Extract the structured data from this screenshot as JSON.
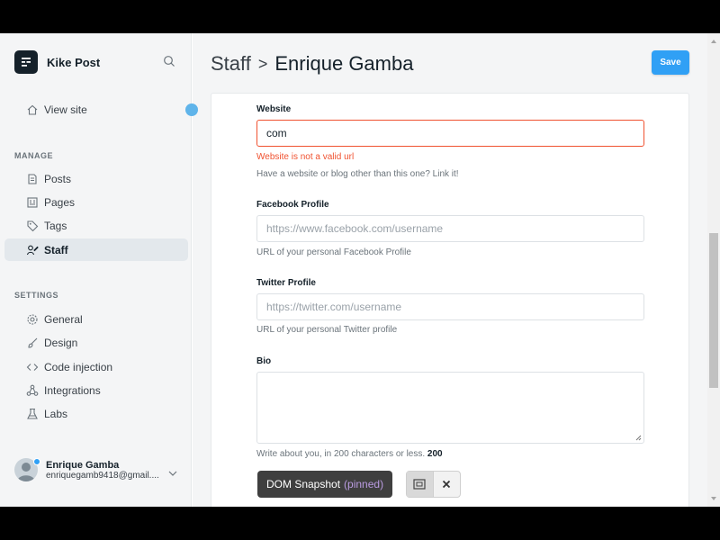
{
  "brand": {
    "name": "Kike Post"
  },
  "sidebar": {
    "view_site": "View site",
    "manage_title": "MANAGE",
    "manage_items": [
      {
        "label": "Posts",
        "icon": "posts-icon"
      },
      {
        "label": "Pages",
        "icon": "pages-icon"
      },
      {
        "label": "Tags",
        "icon": "tag-icon"
      },
      {
        "label": "Staff",
        "icon": "staff-icon",
        "active": true
      }
    ],
    "settings_title": "SETTINGS",
    "settings_items": [
      {
        "label": "General",
        "icon": "gear-icon"
      },
      {
        "label": "Design",
        "icon": "brush-icon"
      },
      {
        "label": "Code injection",
        "icon": "code-icon"
      },
      {
        "label": "Integrations",
        "icon": "integrations-icon"
      },
      {
        "label": "Labs",
        "icon": "flask-icon"
      }
    ],
    "user": {
      "name": "Enrique Gamba",
      "email": "enriquegamb9418@gmail...."
    }
  },
  "header": {
    "breadcrumb_root": "Staff",
    "separator": ">",
    "page_title": "Enrique Gamba",
    "save_label": "Save"
  },
  "form": {
    "website": {
      "label": "Website",
      "value": "com",
      "error": "Website is not a valid url",
      "help": "Have a website or blog other than this one? Link it!"
    },
    "facebook": {
      "label": "Facebook Profile",
      "placeholder": "https://www.facebook.com/username",
      "help": "URL of your personal Facebook Profile"
    },
    "twitter": {
      "label": "Twitter Profile",
      "placeholder": "https://twitter.com/username",
      "help": "URL of your personal Twitter profile"
    },
    "bio": {
      "label": "Bio",
      "help": "Write about you, in 200 characters or less.",
      "count": "200"
    }
  },
  "snapshot": {
    "label": "DOM Snapshot",
    "pinned": "(pinned)"
  },
  "colors": {
    "accent": "#30a0f5",
    "error": "#f05230",
    "sidebar_bg": "#f4f5f6",
    "text": "#15212a"
  }
}
